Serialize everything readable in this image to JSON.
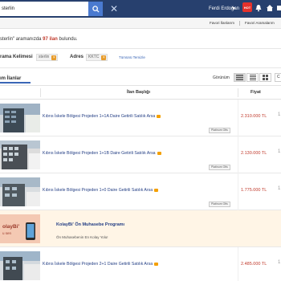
{
  "header": {
    "search_value": "sterlin",
    "user_name": "Ferdi Erdoğan",
    "badge_label": "HOT",
    "colors": {
      "topbar": "#27406e",
      "accent": "#4a7ad0",
      "badge": "#e4312b"
    }
  },
  "sublinks": {
    "favorites": "Favori İlanlarım",
    "favorite_searches": "Favori Aramalarım"
  },
  "results": {
    "prefix": "sterlin\" aramanızda",
    "count": "97 ilan",
    "suffix": "bulundu."
  },
  "filters": {
    "keyword_label": "rama Kelimesi",
    "keyword_value": "sterlin",
    "address_label": "Adres",
    "address_value": "KKTC",
    "clear_all": "Tümünü Temizle"
  },
  "tabs": {
    "active": "ım İlanlar"
  },
  "view": {
    "label": "Görünüm",
    "extra": "C"
  },
  "table_headers": {
    "title": "İlan Başlığı",
    "price": "Fiyat"
  },
  "listings": [
    {
      "title": "Kıbrıs İskele Bölgesi Projeden 1+1A Daire Getirili Satılık Arsa",
      "badge": "Platinum Ofis",
      "price": "2.310.000 TL",
      "arrow": "1"
    },
    {
      "title": "Kıbrıs İskele Bölgesi Projeden 1+1B Daire Getirili Satılık Arsa",
      "badge": "Platinum Ofis",
      "price": "2.130.000 TL",
      "arrow": "1"
    },
    {
      "title": "Kıbrıs İskele Bölgesi Projeden 1+0 Daire Getirili Satılık Arsa",
      "badge": "Platinum Ofis",
      "price": "1.775.000 TL",
      "arrow": "1"
    },
    {
      "title": "Kıbrıs İskele Bölgesi Projeden 2+1 Daire Getirili Satılık Arsa",
      "badge": "",
      "price": "2.485.000 TL",
      "arrow": "1"
    }
  ],
  "ad": {
    "title": "KolayBi' Ön Muhasebe Programı",
    "subtitle": "Ön Muhasebenin En Kolay Yolu!",
    "thumb_text": "olayBi'",
    "thumb_sub": "u sen"
  }
}
